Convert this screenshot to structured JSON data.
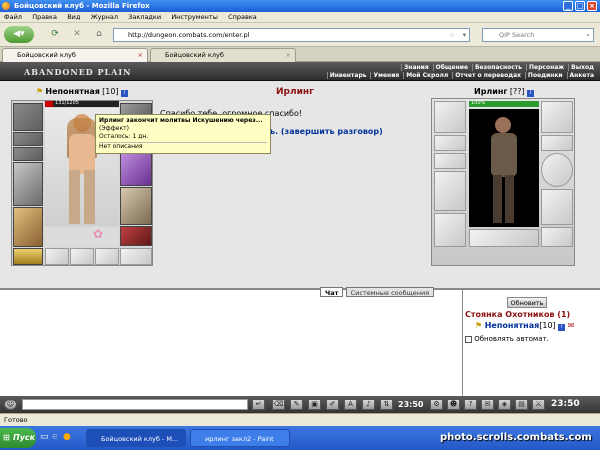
{
  "window": {
    "title": "Бойцовский клуб - Mozilla Firefox"
  },
  "menu": [
    "Файл",
    "Правка",
    "Вид",
    "Журнал",
    "Закладки",
    "Инструменты",
    "Справка"
  ],
  "nav": {
    "url": "http://dungeon.combats.com/enter.pl",
    "search_placeholder": "QIP Search"
  },
  "tabs": [
    {
      "label": "Бойцовский клуб",
      "active": true
    },
    {
      "label": "Бойцовский клуб",
      "active": false
    }
  ],
  "game": {
    "logo": "ABANDONED PLAIN",
    "top_links_1": [
      "Знания",
      "Общение",
      "Безопасность",
      "Персонаж",
      "Выход"
    ],
    "top_links_2": [
      "Инвентарь",
      "Умения",
      "Мой Скролл",
      "Отчет о переводах",
      "Поединки",
      "Анкета"
    ]
  },
  "left_char": {
    "name": "Непонятная",
    "level": "[10]",
    "hp": "131/1205"
  },
  "right_char": {
    "name": "Ирлинг",
    "level": "[??]",
    "hp": "100%"
  },
  "dialog": {
    "npc_name": "Ирлинг",
    "text": "Спасибо тебе, огромное спасибо!",
    "link_partial": "ь. (завершить разговор)"
  },
  "tooltip": {
    "title": "Ирлинг закончит молитвы Искушению через...",
    "effect": "(Эффект)",
    "remaining": "Осталось: 1 дн.",
    "no_desc": "Нет описания"
  },
  "chat": {
    "tabs": [
      "Чат",
      "Системные сообщения"
    ]
  },
  "room": {
    "refresh_btn": "Обновить",
    "title": "Стоянка Охотников (1)",
    "member_name": "Непонятная",
    "member_level": "[10]",
    "auto_refresh_label": "Обновлять автомат."
  },
  "clock": "23:50",
  "status": "Готово",
  "taskbar": {
    "start": "Пуск",
    "tasks": [
      "Бойцовский клуб - М...",
      "ирлинг закл2 - Paint"
    ]
  },
  "watermark": "photo.scrolls.combats.com"
}
